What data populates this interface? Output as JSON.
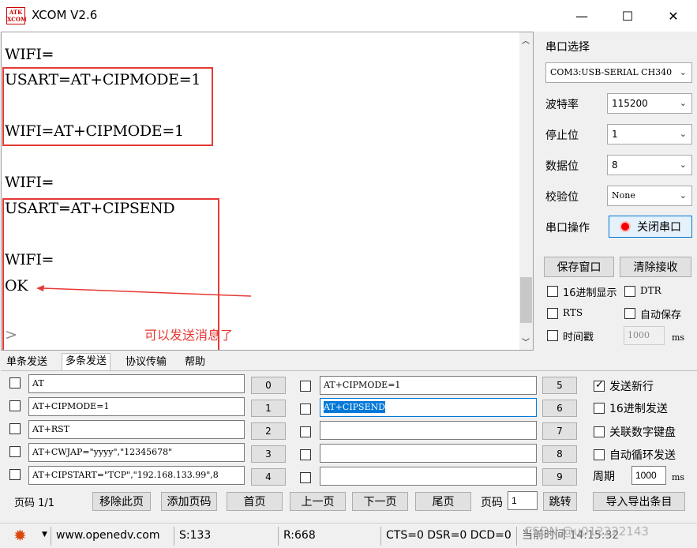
{
  "window": {
    "title": "XCOM V2.6",
    "icon_text_1": "ATK",
    "icon_text_2": "XCOM",
    "min_icon": "—",
    "max_icon": "☐",
    "close_icon": "✕"
  },
  "receive": {
    "lines": [
      "WIFI=",
      "USART=AT+CIPMODE=1",
      "WIFI=AT+CIPMODE=1",
      "WIFI=",
      "USART=AT+CIPSEND",
      "WIFI=",
      "OK"
    ],
    "cursor": ">",
    "annotation": "可以发送消息了",
    "annotation_color": "#e53935"
  },
  "serial": {
    "section_label": "串口选择",
    "port_value": "COM3:USB-SERIAL CH340",
    "baud_label": "波特率",
    "baud_value": "115200",
    "stop_label": "停止位",
    "stop_value": "1",
    "data_label": "数据位",
    "data_value": "8",
    "parity_label": "校验位",
    "parity_value": "None",
    "op_label": "串口操作",
    "op_button": "关闭串口",
    "save_window": "保存窗口",
    "clear_recv": "清除接收",
    "hex_display": "16进制显示",
    "dtr": "DTR",
    "rts": "RTS",
    "auto_save": "自动保存",
    "timestamp": "时间戳",
    "timestamp_ms": "1000",
    "ms": "ms"
  },
  "tabs": [
    "单条发送",
    "多条发送",
    "协议传输",
    "帮助"
  ],
  "multi_send": {
    "left": [
      {
        "value": "AT",
        "num": "0"
      },
      {
        "value": "AT+CIPMODE=1",
        "num": "1"
      },
      {
        "value": "AT+RST",
        "num": "2"
      },
      {
        "value": "AT+CWJAP=\"yyyy\",\"12345678\"",
        "num": "3"
      },
      {
        "value": "AT+CIPSTART=\"TCP\",\"192.168.133.99\",8",
        "num": "4"
      }
    ],
    "right": [
      {
        "value": "AT+CIPMODE=1",
        "num": "5"
      },
      {
        "value": "AT+CIPSEND",
        "num": "6"
      },
      {
        "value": "",
        "num": "7"
      },
      {
        "value": "",
        "num": "8"
      },
      {
        "value": "",
        "num": "9"
      }
    ],
    "send_newline": "发送新行",
    "hex_send": "16进制发送",
    "link_keypad": "关联数字键盘",
    "auto_loop": "自动循环发送",
    "period_label": "周期",
    "period_value": "1000",
    "period_unit": "ms"
  },
  "pager": {
    "page_info": "页码 1/1",
    "remove_page": "移除此页",
    "add_page": "添加页码",
    "first": "首页",
    "prev": "上一页",
    "next": "下一页",
    "last": "尾页",
    "page_label": "页码",
    "page_value": "1",
    "jump": "跳转",
    "import_export": "导入导出条目"
  },
  "status": {
    "url": "www.openedv.com",
    "sent": "S:133",
    "recv": "R:668",
    "signals": "CTS=0 DSR=0 DCD=0",
    "time": "当前时间 14:15:32",
    "watermark": "CSDN @u012222143"
  },
  "colors": {
    "accent_red": "#e53935",
    "selection_blue": "#0078d7"
  }
}
